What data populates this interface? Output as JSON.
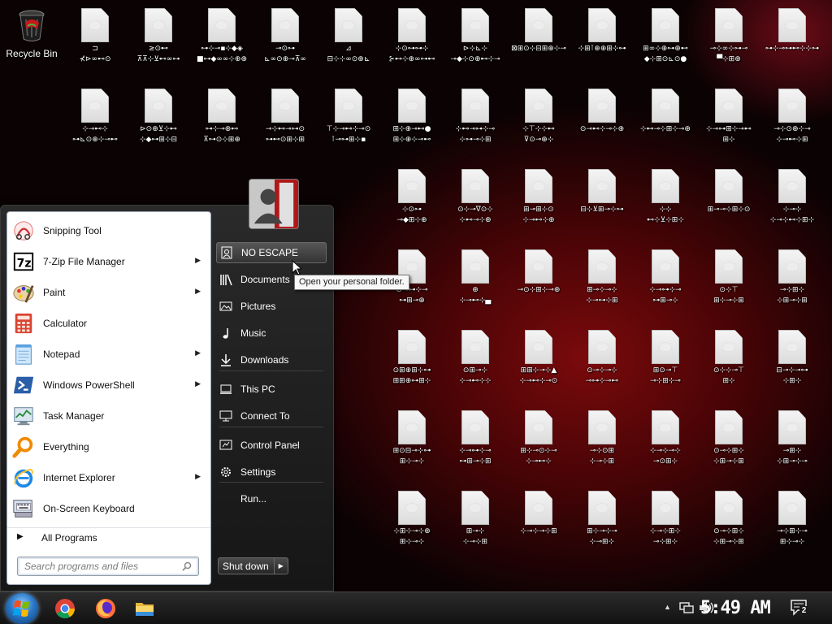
{
  "desktop": {
    "recycle_bin": "Recycle Bin",
    "files": [
      {
        "col": 0,
        "row": 0,
        "label": "⊐\n⊀⊳∞⊷⊙"
      },
      {
        "col": 1,
        "row": 0,
        "label": "≥⊙⊷\n⊼⊼⊹⊻⊷∞⊶"
      },
      {
        "col": 2,
        "row": 0,
        "label": "⊶⊹⊸▪⊹◆◈\n■⊶◆∞∞⊹⊕⊕"
      },
      {
        "col": 3,
        "row": 0,
        "label": "⊸⊙⊶\n⊾∞⊙⊕⊸⊼∞"
      },
      {
        "col": 4,
        "row": 0,
        "label": "⊿\n⊟⊹⊹∞⊙⊕⊾"
      },
      {
        "col": 5,
        "row": 0,
        "label": "⊹⊙⊶⊶⊹\n⊱⊷⊹⊕∞⊶⊷"
      },
      {
        "col": 6,
        "row": 0,
        "label": "⊳⊹⊾⊹\n⊸◆⊹⊙⊕⊷⊹⊸"
      },
      {
        "col": 7,
        "row": 0,
        "label": "⊠⊞⊙⊹⊟⊞⊕⊹⊸"
      },
      {
        "col": 8,
        "row": 0,
        "label": "⊹⊞⊺⊕⊕⊞⊹⊶"
      },
      {
        "col": 9,
        "row": 0,
        "label": "⊞∞⊹⊕⊶⊕⊷\n◆⊹⊞⊙⊾⊙●"
      },
      {
        "col": 10,
        "row": 0,
        "label": "⊸⊹∞⊹⊶⊸\n▀⊹⊞⊕"
      },
      {
        "col": 11,
        "row": 0,
        "label": "⊶⊹⊸⊶⊷⊹⊹⊶"
      },
      {
        "col": 0,
        "row": 1,
        "label": "⊹⊸⊷⊹\n⊶⊾⊙⊕⊹⊸⊷"
      },
      {
        "col": 1,
        "row": 1,
        "label": "⊳⊙⊕⊻⊹⊷\n⊹◆⊶⊞⊹⊟"
      },
      {
        "col": 2,
        "row": 1,
        "label": "⊶⊹⊸⊕⊷\n⊼⊶⊙⊹⊞⊕"
      },
      {
        "col": 3,
        "row": 1,
        "label": "⊸⊹⊷⊸⊶⊙\n⊶⊷⊙⊞⊹⊞"
      },
      {
        "col": 4,
        "row": 1,
        "label": "⊤⊹⊸⊷⊹⊸⊙\n⊺⊸⊶⊞⊹▪"
      },
      {
        "col": 5,
        "row": 1,
        "label": "⊞⊹⊕⊸⊷●\n⊞⊹⊕⊹⊸⊷"
      },
      {
        "col": 6,
        "row": 1,
        "label": "⊹⊷⊸⊶⊹⊸\n⊹⊶⊸⊹⊞"
      },
      {
        "col": 7,
        "row": 1,
        "label": "⊹⊤⊹⊹⊷\n⊽⊙⊸⊕⊹"
      },
      {
        "col": 8,
        "row": 1,
        "label": "⊙⊸⊷⊹⊸⊹⊕"
      },
      {
        "col": 9,
        "row": 1,
        "label": "⊹⊷⊸⊹⊞⊹⊸⊕"
      },
      {
        "col": 10,
        "row": 1,
        "label": "⊹⊸⊶⊞⊹⊸⊷\n⊞⊹"
      },
      {
        "col": 11,
        "row": 1,
        "label": "⊸⊹⊙⊕⊹⊸\n⊹⊸⊷⊹⊞"
      },
      {
        "col": 5,
        "row": 2,
        "label": "⊹⊙⊶\n⊸◆⊞⊹⊕"
      },
      {
        "col": 6,
        "row": 2,
        "label": "⊙⊹⊸∇⊙⊹\n⊹⊷⊸⊹⊕"
      },
      {
        "col": 7,
        "row": 2,
        "label": "⊞⊸⊞⊹⊙\n⊹⊸⊷⊹⊕"
      },
      {
        "col": 8,
        "row": 2,
        "label": "⊟⊹⊻⊞⊸⊹⊶"
      },
      {
        "col": 9,
        "row": 2,
        "label": "⊹⊹\n⊷⊹⊻⊹⊞⊹"
      },
      {
        "col": 10,
        "row": 2,
        "label": "⊞⊸⊸⊹⊞⊹⊙"
      },
      {
        "col": 11,
        "row": 2,
        "label": "⊹⊸⊹\n⊹⊸⊹⊷⊹⊞⊹"
      },
      {
        "col": 5,
        "row": 3,
        "label": "⊙⊸⊶⊹⊸\n⊶⊞⊸⊕"
      },
      {
        "col": 6,
        "row": 3,
        "label": "⊕\n⊹⊸⊷⊹▄"
      },
      {
        "col": 7,
        "row": 3,
        "label": "⊸⊙⊹⊞⊹⊸⊕"
      },
      {
        "col": 8,
        "row": 3,
        "label": "⊞⊸⊹⊸⊹\n⊹⊸⊶⊹⊞"
      },
      {
        "col": 9,
        "row": 3,
        "label": "⊹⊸⊶⊹⊸\n⊶⊞⊸⊹"
      },
      {
        "col": 10,
        "row": 3,
        "label": "⊙⊹⊤\n⊞⊹⊸⊹⊞"
      },
      {
        "col": 11,
        "row": 3,
        "label": "⊸⊹⊞⊹\n⊹⊞⊸⊹⊞"
      },
      {
        "col": 5,
        "row": 4,
        "label": "⊙⊞⊕⊞⊹⊶\n⊞⊞⊕⊶⊞⊹"
      },
      {
        "col": 6,
        "row": 4,
        "label": "⊙⊞⊸⊹\n⊹⊸⊷⊹⊹"
      },
      {
        "col": 7,
        "row": 4,
        "label": "⊞⊞⊹⊸⊹▲\n⊹⊸⊷⊹⊸⊙"
      },
      {
        "col": 8,
        "row": 4,
        "label": "⊙⊸⊹⊸⊹\n⊸⊶⊹⊸⊷"
      },
      {
        "col": 9,
        "row": 4,
        "label": "⊞⊙⊸⊤\n⊸⊹⊞⊹⊸"
      },
      {
        "col": 10,
        "row": 4,
        "label": "⊙⊹⊹⊸⊤\n⊞⊹"
      },
      {
        "col": 11,
        "row": 4,
        "label": "⊟⊸⊹⊸⊶\n⊹⊞⊹"
      },
      {
        "col": 5,
        "row": 5,
        "label": "⊞⊙⊟⊸⊹⊶\n⊞⊹⊸⊹"
      },
      {
        "col": 6,
        "row": 5,
        "label": "⊹⊸⊶⊹⊸\n⊶⊞⊸⊹⊞"
      },
      {
        "col": 7,
        "row": 5,
        "label": "⊞⊹⊸⊙⊹⊸\n⊹⊸⊷⊹"
      },
      {
        "col": 8,
        "row": 5,
        "label": "⊸⊹⊙⊞\n⊹⊸⊹⊞"
      },
      {
        "col": 9,
        "row": 5,
        "label": "⊹⊸⊹⊸⊹\n⊸⊙⊞⊹"
      },
      {
        "col": 10,
        "row": 5,
        "label": "⊙⊸⊹⊞⊹\n⊹⊞⊸⊹⊞"
      },
      {
        "col": 11,
        "row": 5,
        "label": "⊸⊞⊹\n⊹⊞⊸⊹⊸"
      },
      {
        "col": 5,
        "row": 6,
        "label": "⊹⊞⊹⊸⊹⊕\n⊞⊹⊸⊹"
      },
      {
        "col": 6,
        "row": 6,
        "label": "⊞⊸⊹\n⊹⊸⊹⊞"
      },
      {
        "col": 7,
        "row": 6,
        "label": "⊹⊸⊹⊸⊹⊞"
      },
      {
        "col": 8,
        "row": 6,
        "label": "⊞⊹⊸⊹⊸\n⊹⊸⊞⊹"
      },
      {
        "col": 9,
        "row": 6,
        "label": "⊹⊸⊹⊞⊹\n⊸⊹⊞⊹"
      },
      {
        "col": 10,
        "row": 6,
        "label": "⊙⊸⊹⊞⊹\n⊹⊞⊸⊹⊞"
      },
      {
        "col": 11,
        "row": 6,
        "label": "⊸⊹⊞⊹⊸\n⊞⊹⊸⊹"
      }
    ]
  },
  "start_menu": {
    "programs": [
      {
        "label": "Snipping Tool",
        "icon": "snipping-tool-icon",
        "submenu": false
      },
      {
        "label": "7-Zip File Manager",
        "icon": "7zip-icon",
        "submenu": true
      },
      {
        "label": "Paint",
        "icon": "paint-icon",
        "submenu": true
      },
      {
        "label": "Calculator",
        "icon": "calculator-icon",
        "submenu": false
      },
      {
        "label": "Notepad",
        "icon": "notepad-icon",
        "submenu": true
      },
      {
        "label": "Windows PowerShell",
        "icon": "powershell-icon",
        "submenu": true
      },
      {
        "label": "Task Manager",
        "icon": "task-manager-icon",
        "submenu": false
      },
      {
        "label": "Everything",
        "icon": "everything-search-icon",
        "submenu": false
      },
      {
        "label": "Internet Explorer",
        "icon": "internet-explorer-icon",
        "submenu": true
      },
      {
        "label": "On-Screen Keyboard",
        "icon": "keyboard-icon",
        "submenu": false
      }
    ],
    "all_programs": "All Programs",
    "search_placeholder": "Search programs and files",
    "right_items": [
      {
        "label": "NO ESCAPE",
        "icon": "user-folder-icon"
      },
      {
        "label": "Documents",
        "icon": "documents-icon"
      },
      {
        "label": "Pictures",
        "icon": "pictures-icon"
      },
      {
        "label": "Music",
        "icon": "music-icon"
      },
      {
        "label": "Downloads",
        "icon": "downloads-icon"
      },
      {
        "label": "This PC",
        "icon": "computer-icon"
      },
      {
        "label": "Connect To",
        "icon": "connect-to-icon"
      },
      {
        "label": "Control Panel",
        "icon": "control-panel-icon"
      },
      {
        "label": "Settings",
        "icon": "settings-gear-icon"
      },
      {
        "label": "Run...",
        "icon": "run-icon"
      }
    ],
    "shutdown_label": "Shut down",
    "tooltip": "Open your personal folder."
  },
  "taskbar": {
    "apps": [
      "chrome-icon",
      "firefox-icon",
      "file-explorer-icon"
    ],
    "clock": "5:49 AM",
    "notification_count": "2"
  },
  "colors": {
    "accent": "#2a78c8",
    "highlight": "#4a4a4a",
    "wallpaper_red": "#7a0a0c"
  }
}
